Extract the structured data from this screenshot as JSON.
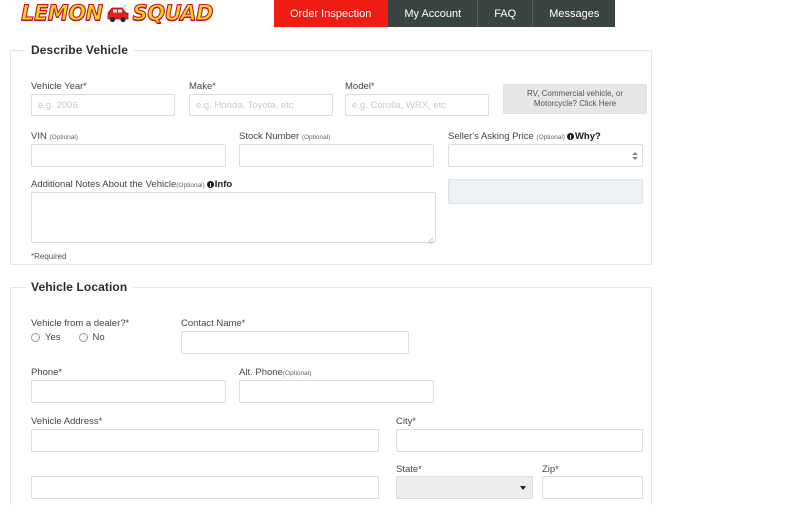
{
  "brand": {
    "logo_text_left": "LEMON",
    "logo_text_right": "SQUAD",
    "logo_icon": "red-car-icon",
    "color_yellow": "#F5D417",
    "color_red": "#C8102E"
  },
  "nav": {
    "active_color": "#EE1C12",
    "bar_color": "#3A4543",
    "tabs": [
      {
        "label": "Order Inspection",
        "active": true
      },
      {
        "label": "My Account",
        "active": false
      },
      {
        "label": "FAQ",
        "active": false
      },
      {
        "label": "Messages",
        "active": false
      }
    ]
  },
  "describe_vehicle": {
    "legend": "Describe Vehicle",
    "vehicle_year": {
      "label": "Vehicle Year",
      "required_mark": "*",
      "placeholder": "e.g. 2006",
      "value": ""
    },
    "make": {
      "label": "Make",
      "required_mark": "*",
      "placeholder": "e.g. Honda, Toyota, etc",
      "value": ""
    },
    "model": {
      "label": "Model",
      "required_mark": "*",
      "placeholder": "e.g. Corolla, WRX, etc",
      "value": ""
    },
    "rv_button": {
      "line1": "RV, Commercial vehicle, or",
      "line2": "Motorcycle? Click Here"
    },
    "vin": {
      "label": "VIN",
      "optional": "(Optional)",
      "value": ""
    },
    "stock_number": {
      "label": "Stock Number",
      "optional": "(Optional)",
      "value": ""
    },
    "asking_price": {
      "label": "Seller's Asking Price",
      "optional": "(Optional)",
      "why_link": "Why?",
      "why_icon": "info-icon",
      "value": "",
      "spinner": "number-spinner"
    },
    "notes": {
      "label": "Additional Notes About the Vehicle",
      "optional": "(Optional)",
      "info_link": "Info",
      "info_icon": "info-icon",
      "value": ""
    },
    "side_field": {
      "value": "",
      "disabled": true
    },
    "required_note": "*Required"
  },
  "vehicle_location": {
    "legend": "Vehicle Location",
    "dealer": {
      "label": "Vehicle from a dealer?",
      "required_mark": "*",
      "options": [
        {
          "label": "Yes",
          "selected": false
        },
        {
          "label": "No",
          "selected": false
        }
      ]
    },
    "contact_name": {
      "label": "Contact Name",
      "required_mark": "*",
      "value": ""
    },
    "phone": {
      "label": "Phone",
      "required_mark": "*",
      "value": ""
    },
    "alt_phone": {
      "label": "Alt. Phone",
      "optional": "(Optional)",
      "value": ""
    },
    "vehicle_address": {
      "label": "Vehicle Address",
      "required_mark": "*",
      "value": ""
    },
    "city": {
      "label": "City",
      "required_mark": "*",
      "value": ""
    },
    "address_line_2": {
      "value": ""
    },
    "state": {
      "label": "State",
      "required_mark": "*",
      "selected": ""
    },
    "zip": {
      "label": "Zip",
      "required_mark": "*",
      "value": ""
    }
  }
}
